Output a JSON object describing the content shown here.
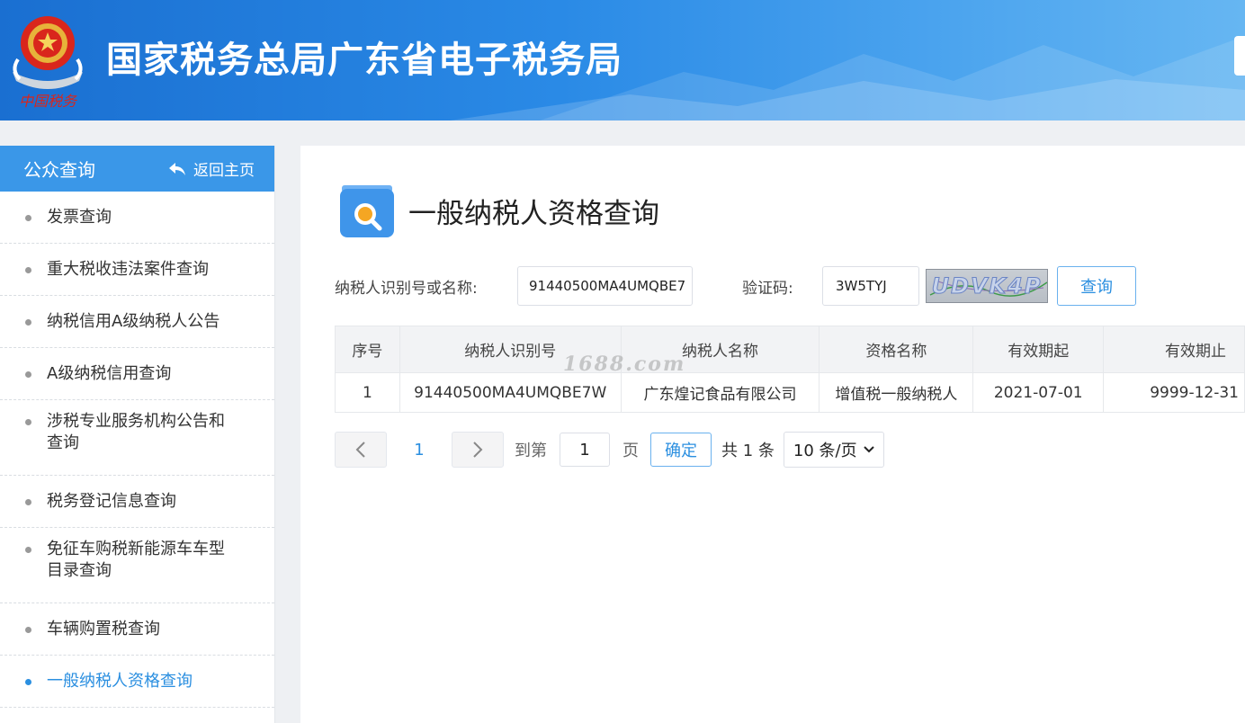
{
  "header": {
    "site_title": "国家税务总局广东省电子税务局",
    "emblem_text": "中国税务"
  },
  "sidebar": {
    "title": "公众查询",
    "back_label": "返回主页",
    "items": [
      {
        "label": "发票查询",
        "active": false
      },
      {
        "label": "重大税收违法案件查询",
        "active": false
      },
      {
        "label": "纳税信用A级纳税人公告",
        "active": false
      },
      {
        "label": "A级纳税信用查询",
        "active": false
      },
      {
        "label": "涉税专业服务机构公告和查询",
        "active": false
      },
      {
        "label": "税务登记信息查询",
        "active": false
      },
      {
        "label": "免征车购税新能源车车型目录查询",
        "active": false
      },
      {
        "label": "车辆购置税查询",
        "active": false
      },
      {
        "label": "一般纳税人资格查询",
        "active": true
      }
    ]
  },
  "main": {
    "page_title": "一般纳税人资格查询",
    "form": {
      "taxpayer_label": "纳税人识别号或名称:",
      "taxpayer_value": "91440500MA4UMQBE7",
      "captcha_label": "验证码:",
      "captcha_value": "3W5TYJ",
      "captcha_image_text": "UDVK4P",
      "query_label": "查询"
    },
    "table": {
      "headers": [
        "序号",
        "纳税人识别号",
        "纳税人名称",
        "资格名称",
        "有效期起",
        "有效期止"
      ],
      "rows": [
        [
          "1",
          "91440500MA4UMQBE7W",
          "广东煌记食品有限公司",
          "增值税一般纳税人",
          "2021-07-01",
          "9999-12-31"
        ]
      ]
    },
    "watermark": "1688.com",
    "pager": {
      "current_page": "1",
      "goto_prefix": "到第",
      "goto_value": "1",
      "goto_suffix": "页",
      "confirm_label": "确定",
      "total_text": "共 1 条",
      "page_size": "10 条/页"
    }
  },
  "colors": {
    "header_blue": "#2a8ae6",
    "sidebar_head": "#3a97e8",
    "accent": "#2b8fe0"
  }
}
